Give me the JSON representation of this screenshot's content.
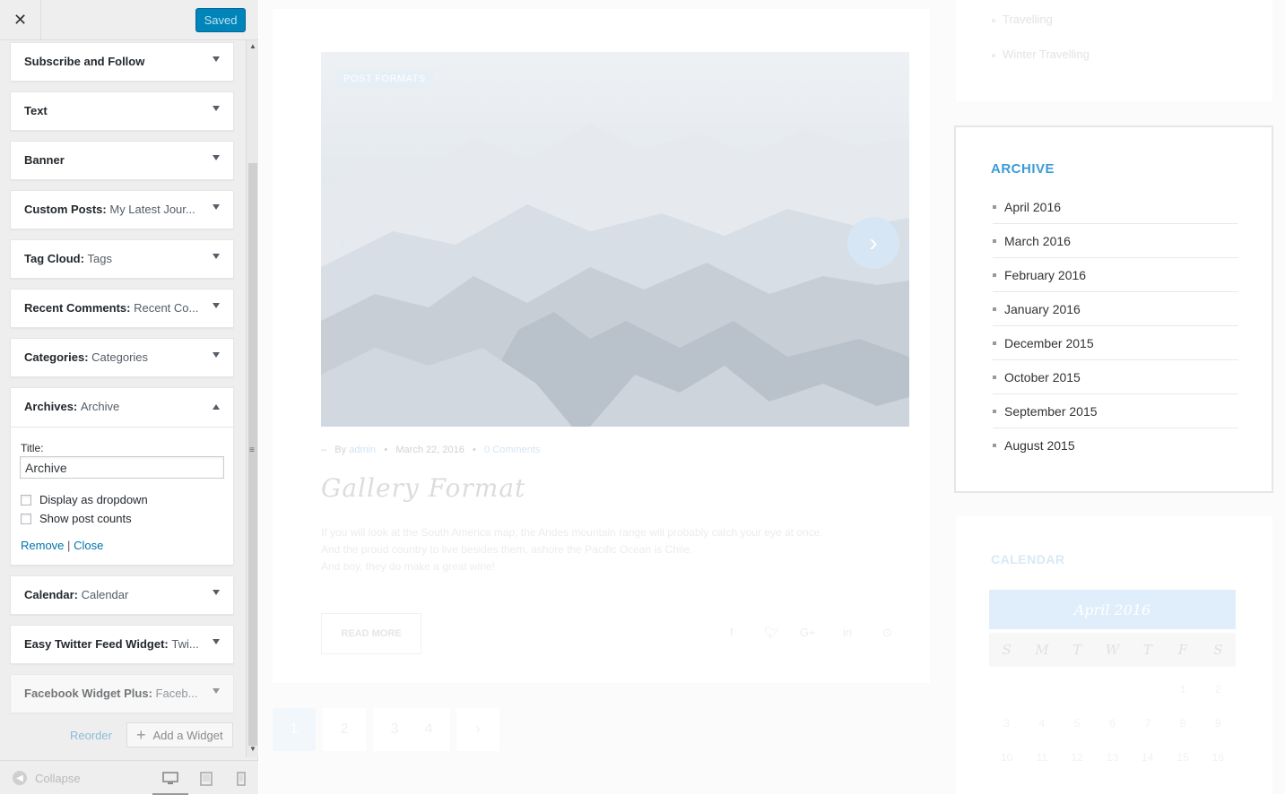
{
  "customizer": {
    "close_icon": "close-icon",
    "saved_label": "Saved",
    "widgets": [
      {
        "name": "Subscribe and Follow",
        "sub": ""
      },
      {
        "name": "Text",
        "sub": ""
      },
      {
        "name": "Banner",
        "sub": ""
      },
      {
        "name": "Custom Posts",
        "sub": "My Latest Jour..."
      },
      {
        "name": "Tag Cloud",
        "sub": "Tags"
      },
      {
        "name": "Recent Comments",
        "sub": "Recent Co..."
      },
      {
        "name": "Categories",
        "sub": "Categories"
      },
      {
        "name": "Archives",
        "sub": "Archive"
      },
      {
        "name": "Calendar",
        "sub": "Calendar"
      },
      {
        "name": "Easy Twitter Feed Widget",
        "sub": "Twi..."
      },
      {
        "name": "Facebook Widget Plus",
        "sub": "Faceb..."
      }
    ],
    "archives_form": {
      "title_label": "Title:",
      "title_value": "Archive",
      "dropdown_label": "Display as dropdown",
      "counts_label": "Show post counts",
      "remove_label": "Remove",
      "separator": "|",
      "close_label": "Close"
    },
    "reorder_label": "Reorder",
    "add_widget_label": "Add a Widget",
    "collapse_label": "Collapse"
  },
  "preview": {
    "post": {
      "badge": "POST FORMATS",
      "meta_dash": "–",
      "meta_by": "By",
      "author": "admin",
      "meta_dot": "•",
      "date": "March 22, 2016",
      "comments": "0 Comments",
      "title": "Gallery Format",
      "excerpt_lines": [
        "If you will look at the South America map, the Andes mountain range will probably catch your eye at once.",
        "And the proud country to live besides them, ashore the Pacific Ocean is Chile.",
        "And boy, they do make a great wine!"
      ],
      "read_more": "READ MORE",
      "share_icons": [
        "facebook-icon",
        "twitter-icon",
        "google-plus-icon",
        "linkedin-icon",
        "pinterest-icon"
      ]
    },
    "pagination": [
      "1",
      "2",
      "3",
      "4",
      "›"
    ],
    "top_widget_items": [
      "Travelling",
      "Winter Travelling"
    ],
    "archive": {
      "title": "ARCHIVE",
      "items": [
        "April 2016",
        "March 2016",
        "February 2016",
        "January 2016",
        "December 2015",
        "October 2015",
        "September 2015",
        "August 2015"
      ]
    },
    "calendar": {
      "title": "CALENDAR",
      "month": "April 2016",
      "days": [
        "S",
        "M",
        "T",
        "W",
        "T",
        "F",
        "S"
      ],
      "rows": [
        [
          "",
          "",
          "",
          "",
          "",
          "1",
          "2"
        ],
        [
          "3",
          "4",
          "5",
          "6",
          "7",
          "8",
          "9"
        ],
        [
          "10",
          "11",
          "12",
          "13",
          "14",
          "15",
          "16"
        ]
      ]
    },
    "colors": {
      "accent": "#3b9bd6",
      "saved_button": "#0085ba"
    }
  }
}
